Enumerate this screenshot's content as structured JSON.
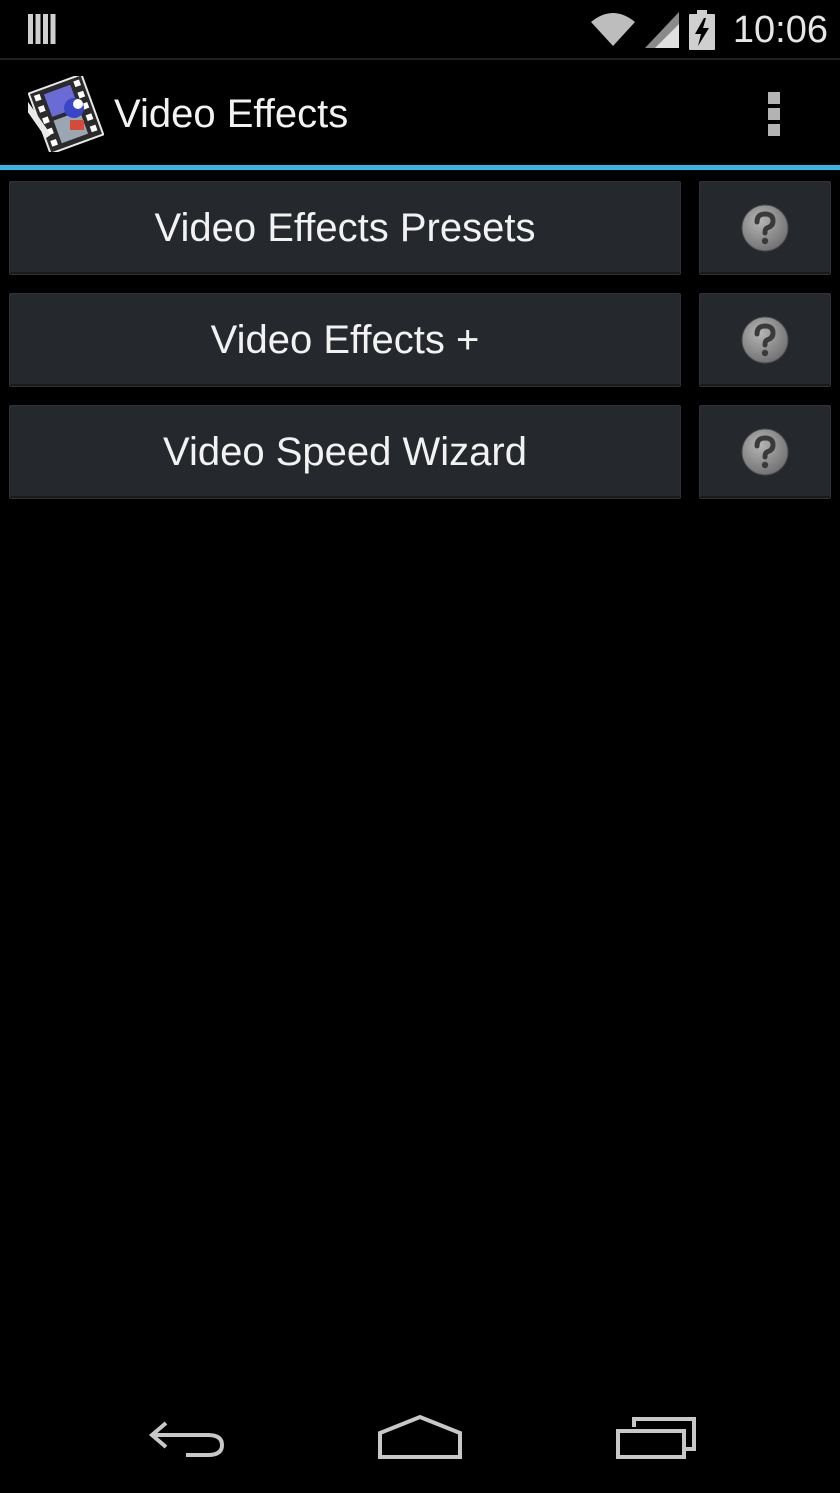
{
  "status_bar": {
    "time": "10:06",
    "icons": [
      "notification-bars-icon",
      "wifi-icon",
      "cell-signal-icon",
      "battery-charging-icon"
    ]
  },
  "action_bar": {
    "title": "Video Effects",
    "app_icon": "video-effects-app-icon",
    "overflow_icon": "overflow-menu-icon",
    "accent_color": "#33b5e5"
  },
  "menu": {
    "items": [
      {
        "label": "Video Effects Presets",
        "help_icon": "help-icon"
      },
      {
        "label": "Video Effects +",
        "help_icon": "help-icon"
      },
      {
        "label": "Video Speed Wizard",
        "help_icon": "help-icon"
      }
    ]
  },
  "nav_bar": {
    "buttons": [
      "back-icon",
      "home-icon",
      "recent-apps-icon"
    ]
  },
  "colors": {
    "background": "#000000",
    "button_bg": "#25282c",
    "accent": "#33b5e5"
  }
}
